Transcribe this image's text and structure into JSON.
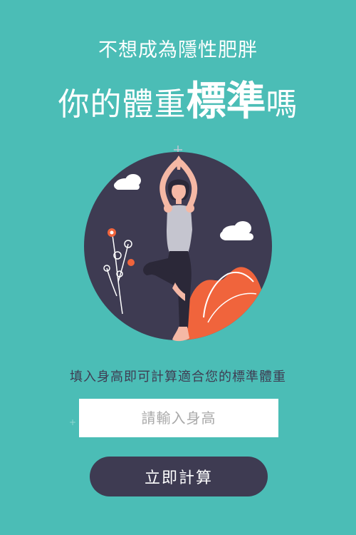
{
  "header": {
    "subtitle": "不想成為隱性肥胖",
    "headline_prefix": "你的體重",
    "headline_emphasis": "標準",
    "headline_suffix": "嗎"
  },
  "illustration": {
    "icon": "yoga-illustration",
    "colors": {
      "circle": "#3e3b52",
      "plant": "#f0643c",
      "skin": "#f5b8a5",
      "shirt": "#c5c5cf",
      "clouds": "#ffffff"
    }
  },
  "form": {
    "instruction": "填入身高即可計算適合您的標準體重",
    "height_placeholder": "請輸入身高",
    "height_value": "",
    "submit_label": "立即計算"
  },
  "theme": {
    "background": "#4bbdb6",
    "button": "#3e3b52",
    "text_dark": "#3f3c52"
  }
}
